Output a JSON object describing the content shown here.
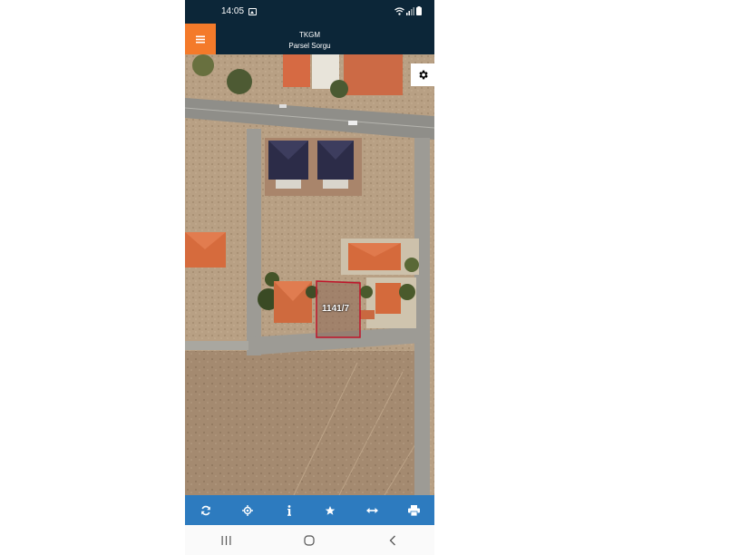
{
  "status_bar": {
    "time": "14:05",
    "icons": [
      "gallery-icon",
      "wifi-icon",
      "signal-icon",
      "battery-icon"
    ]
  },
  "header": {
    "title": "TKGM",
    "subtitle": "Parsel Sorgu",
    "menu_icon": "menu-icon",
    "accent_color": "#f47a2a",
    "background_color": "#0c2638"
  },
  "map": {
    "settings_icon": "gear-icon",
    "parcel_label": "1141/7",
    "parcel_outline_color": "#c0142a"
  },
  "toolbar": {
    "background_color": "#2d7bbf",
    "tools": [
      {
        "name": "refresh",
        "icon": "refresh-icon"
      },
      {
        "name": "locate",
        "icon": "crosshair-icon"
      },
      {
        "name": "info",
        "icon": "info-icon"
      },
      {
        "name": "favorite",
        "icon": "star-icon"
      },
      {
        "name": "measure",
        "icon": "measure-icon"
      },
      {
        "name": "print",
        "icon": "print-icon"
      }
    ]
  },
  "nav_bar": {
    "buttons": [
      "recent-apps-icon",
      "home-icon",
      "back-icon"
    ]
  }
}
